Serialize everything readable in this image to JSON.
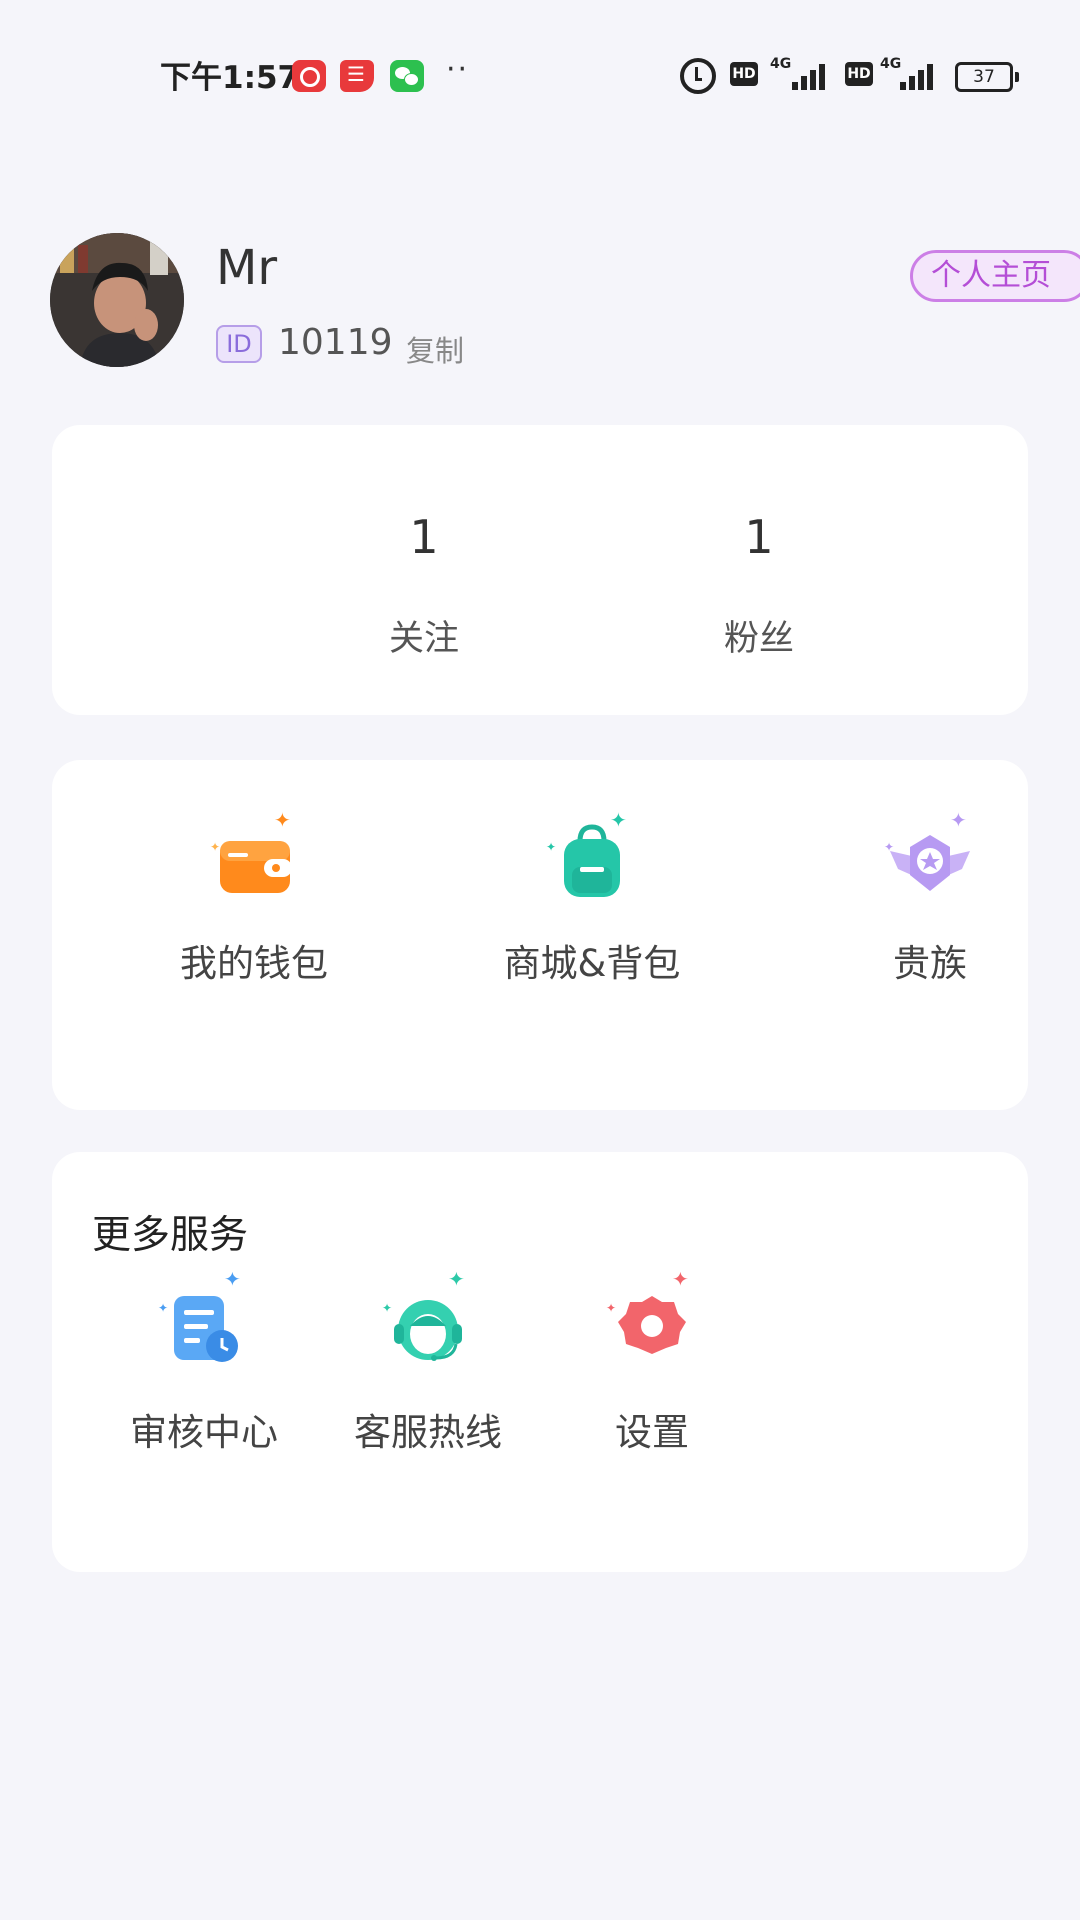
{
  "status_bar": {
    "time": "下午1:57",
    "dots": "··",
    "network_1": "4G",
    "network_2": "4G",
    "hd_1": "HD",
    "hd_2": "HD",
    "battery": "37"
  },
  "profile": {
    "username": "Mr",
    "id_tag": "ID",
    "id_value": "10119",
    "copy_label": "复制",
    "homepage_label": "个人主页"
  },
  "stats": {
    "following_count": "1",
    "following_label": "关注",
    "fans_count": "1",
    "fans_label": "粉丝"
  },
  "features": [
    {
      "label": "我的钱包",
      "icon": "wallet-icon",
      "color": "#ff8a1c"
    },
    {
      "label": "商城&背包",
      "icon": "backpack-icon",
      "color": "#25c6a8"
    },
    {
      "label": "贵族",
      "icon": "noble-badge-icon",
      "color": "#b79af2"
    }
  ],
  "services": {
    "title": "更多服务",
    "items": [
      {
        "label": "审核中心",
        "icon": "review-document-icon",
        "color": "#4a9df2"
      },
      {
        "label": "客服热线",
        "icon": "customer-service-headset-icon",
        "color": "#2cc9a8"
      },
      {
        "label": "设置",
        "icon": "settings-gear-icon",
        "color": "#f2656b"
      }
    ]
  },
  "colors": {
    "background": "#f5f5fa",
    "card": "#ffffff",
    "homepage_accent": "#b44ed6",
    "id_badge": "#8a6cdb"
  }
}
